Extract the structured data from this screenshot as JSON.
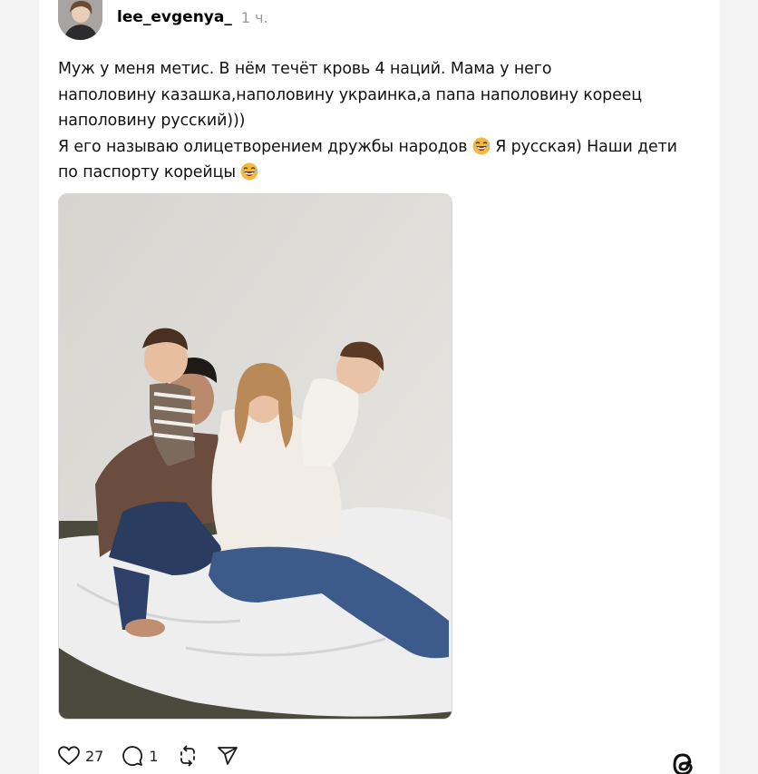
{
  "post": {
    "username": "lee_evgenya_",
    "time": "1 ч.",
    "text_line1": "Муж у меня метис. В нём течёт кровь 4 наций. Мама у него",
    "text_line2": "наполовину казашка,наполовину украинка,а папа наполовину кореец",
    "text_line3": "наполовину русский)))",
    "text_line4a": "Я его называю олицетворением дружбы народов ",
    "text_line4b": " Я русская) Наши дети",
    "text_line5": "по паспорту корейцы ",
    "emoji": "laughing-face-emoji",
    "image": "family-photo"
  },
  "actions": {
    "likes": "27",
    "comments": "1"
  },
  "icons": [
    "heart-icon",
    "comment-icon",
    "repost-icon",
    "share-icon",
    "threads-logo-icon"
  ]
}
